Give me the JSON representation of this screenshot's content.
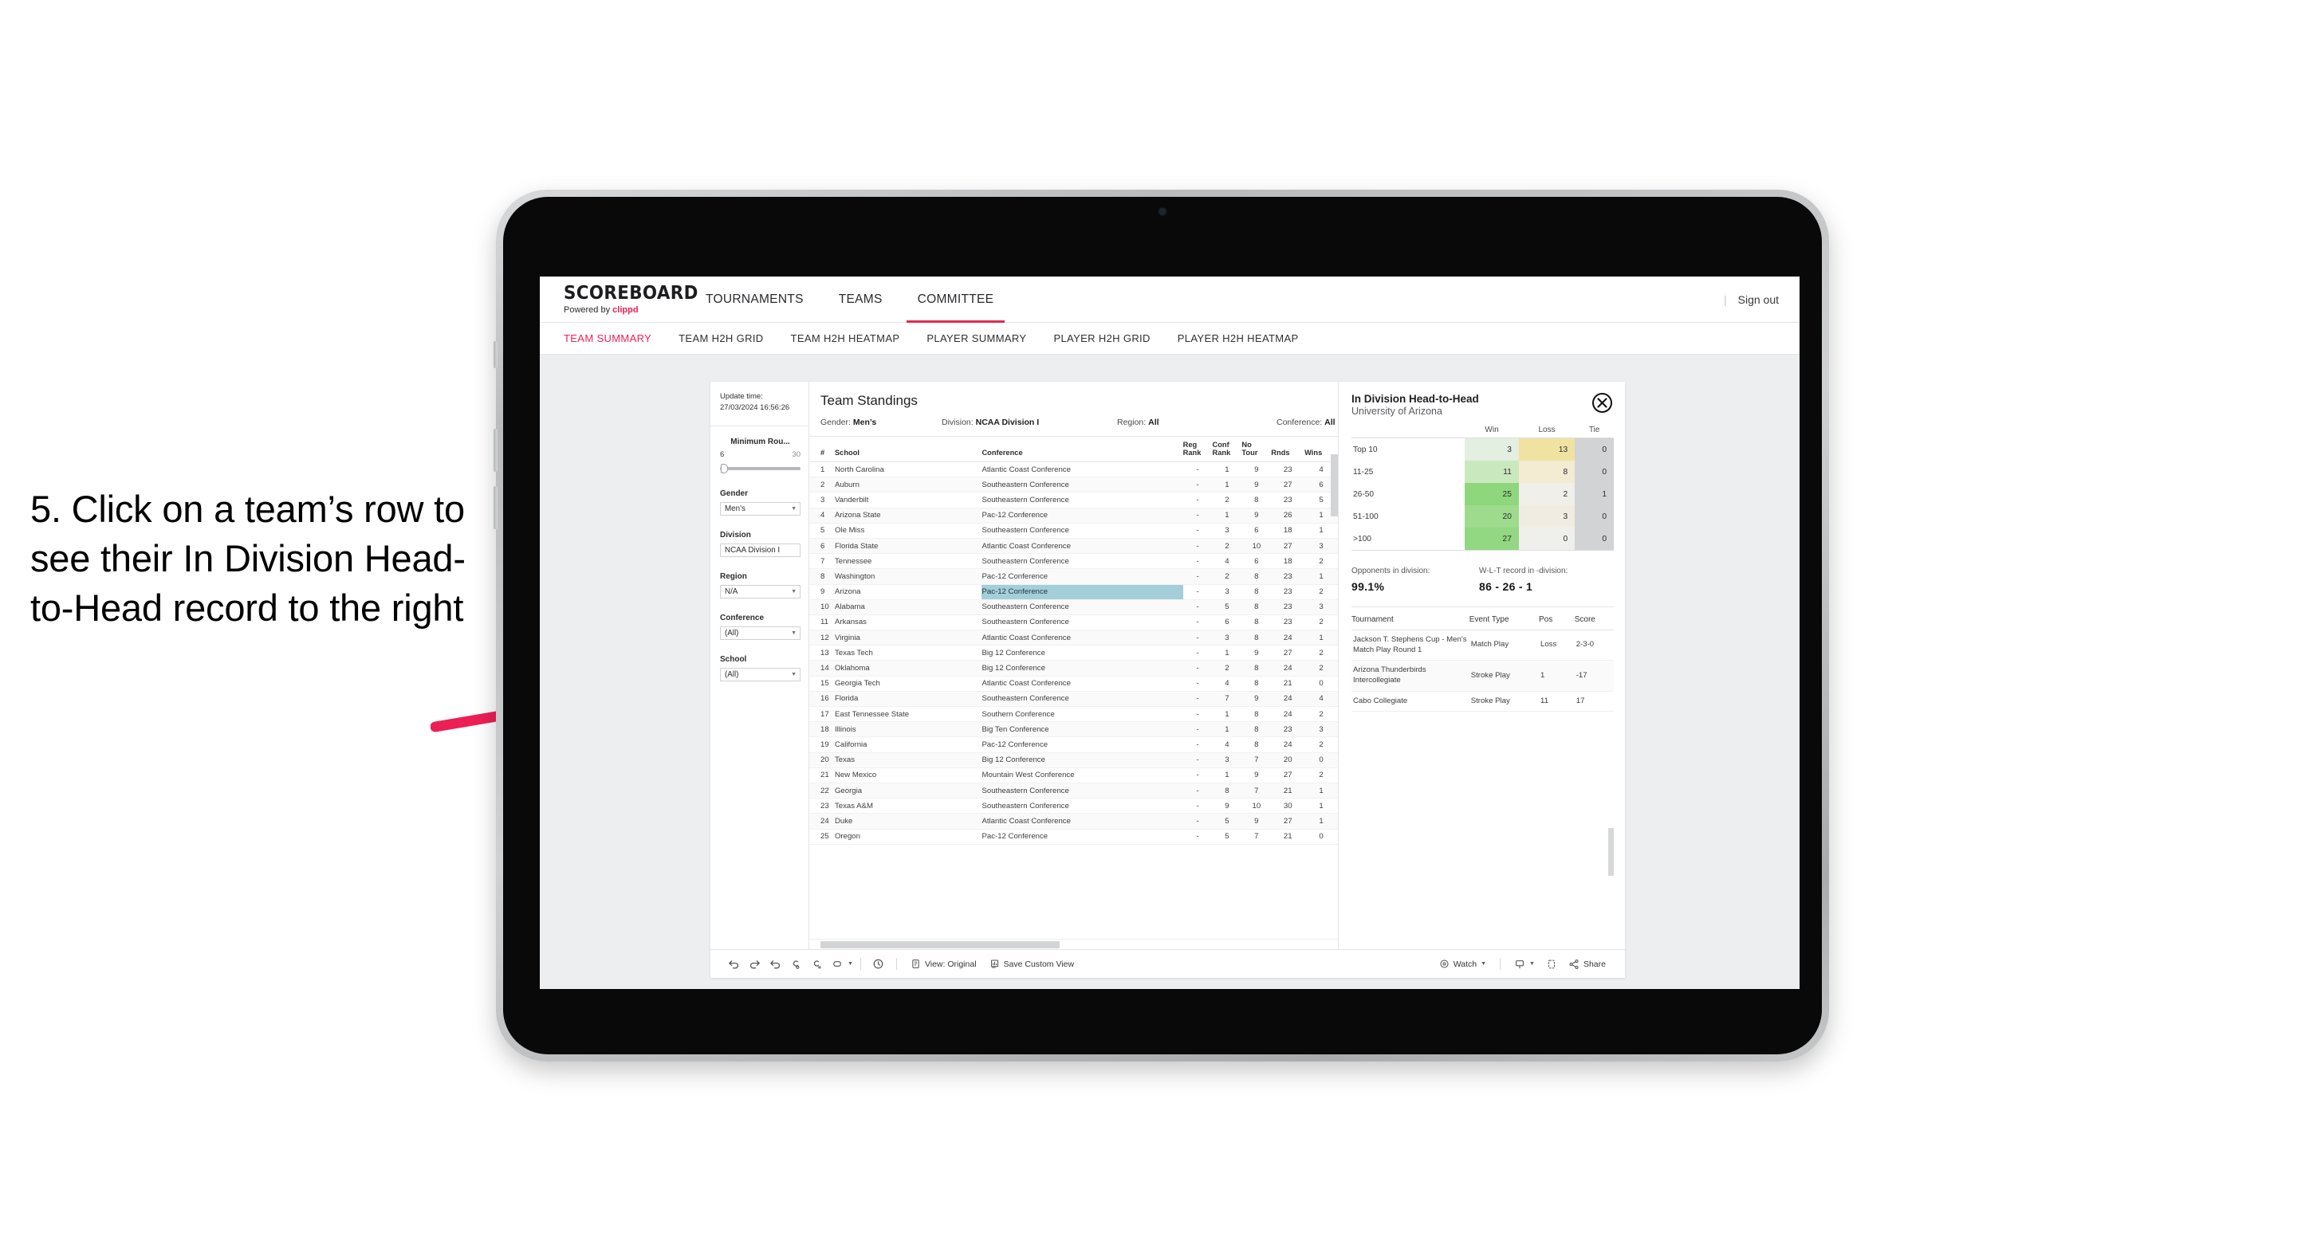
{
  "annotation": {
    "text": "5. Click on a team’s row to see their In Division Head-to-Head record to the right",
    "arrow_color": "#ec2055"
  },
  "app": {
    "logo": {
      "main": "SCOREBOARD",
      "powered_prefix": "Powered by ",
      "brand": "clippd"
    },
    "top_nav": [
      {
        "label": "TOURNAMENTS",
        "active": false
      },
      {
        "label": "TEAMS",
        "active": false
      },
      {
        "label": "COMMITTEE",
        "active": true
      }
    ],
    "sign_out": "Sign out",
    "divider": "|",
    "sub_nav": [
      {
        "label": "TEAM SUMMARY",
        "active": true
      },
      {
        "label": "TEAM H2H GRID",
        "active": false
      },
      {
        "label": "TEAM H2H HEATMAP",
        "active": false
      },
      {
        "label": "PLAYER SUMMARY",
        "active": false
      },
      {
        "label": "PLAYER H2H GRID",
        "active": false
      },
      {
        "label": "PLAYER H2H HEATMAP",
        "active": false
      }
    ]
  },
  "filters": {
    "update_time_label": "Update time:",
    "update_time_value": "27/03/2024 16:56:26",
    "min_rounds": {
      "label": "Minimum Rou...",
      "min": "6",
      "max": "30"
    },
    "gender": {
      "label": "Gender",
      "value": "Men’s"
    },
    "division": {
      "label": "Division",
      "value": "NCAA Division I"
    },
    "region": {
      "label": "Region",
      "value": "N/A"
    },
    "conference": {
      "label": "Conference",
      "value": "(All)"
    },
    "school": {
      "label": "School",
      "value": "(All)"
    }
  },
  "standings": {
    "title": "Team Standings",
    "meta": {
      "gender_label": "Gender: ",
      "gender_value": "Men’s",
      "division_label": "Division: ",
      "division_value": "NCAA Division I",
      "region_label": "Region: ",
      "region_value": "All",
      "conference_label": "Conference: ",
      "conference_value": "All"
    },
    "columns": [
      "#",
      "School",
      "Conference",
      "Reg Rank",
      "Conf Rank",
      "No Tour",
      "Rnds",
      "Wins"
    ],
    "columns_split": [
      {
        "l1": "#",
        "l2": ""
      },
      {
        "l1": "School",
        "l2": ""
      },
      {
        "l1": "Conference",
        "l2": ""
      },
      {
        "l1": "Reg",
        "l2": "Rank"
      },
      {
        "l1": "Conf",
        "l2": "Rank"
      },
      {
        "l1": "No",
        "l2": "Tour"
      },
      {
        "l1": "",
        "l2": "Rnds"
      },
      {
        "l1": "",
        "l2": "Wins"
      }
    ],
    "highlight_rank": 9,
    "rows": [
      {
        "rank": "1",
        "school": "North Carolina",
        "conference": "Atlantic Coast Conference",
        "reg_rank": "-",
        "conf_rank": "1",
        "no_tour": "9",
        "rnds": "23",
        "wins": "4"
      },
      {
        "rank": "2",
        "school": "Auburn",
        "conference": "Southeastern Conference",
        "reg_rank": "-",
        "conf_rank": "1",
        "no_tour": "9",
        "rnds": "27",
        "wins": "6"
      },
      {
        "rank": "3",
        "school": "Vanderbilt",
        "conference": "Southeastern Conference",
        "reg_rank": "-",
        "conf_rank": "2",
        "no_tour": "8",
        "rnds": "23",
        "wins": "5"
      },
      {
        "rank": "4",
        "school": "Arizona State",
        "conference": "Pac-12 Conference",
        "reg_rank": "-",
        "conf_rank": "1",
        "no_tour": "9",
        "rnds": "26",
        "wins": "1"
      },
      {
        "rank": "5",
        "school": "Ole Miss",
        "conference": "Southeastern Conference",
        "reg_rank": "-",
        "conf_rank": "3",
        "no_tour": "6",
        "rnds": "18",
        "wins": "1"
      },
      {
        "rank": "6",
        "school": "Florida State",
        "conference": "Atlantic Coast Conference",
        "reg_rank": "-",
        "conf_rank": "2",
        "no_tour": "10",
        "rnds": "27",
        "wins": "3"
      },
      {
        "rank": "7",
        "school": "Tennessee",
        "conference": "Southeastern Conference",
        "reg_rank": "-",
        "conf_rank": "4",
        "no_tour": "6",
        "rnds": "18",
        "wins": "2"
      },
      {
        "rank": "8",
        "school": "Washington",
        "conference": "Pac-12 Conference",
        "reg_rank": "-",
        "conf_rank": "2",
        "no_tour": "8",
        "rnds": "23",
        "wins": "1"
      },
      {
        "rank": "9",
        "school": "Arizona",
        "conference": "Pac-12 Conference",
        "reg_rank": "-",
        "conf_rank": "3",
        "no_tour": "8",
        "rnds": "23",
        "wins": "2"
      },
      {
        "rank": "10",
        "school": "Alabama",
        "conference": "Southeastern Conference",
        "reg_rank": "-",
        "conf_rank": "5",
        "no_tour": "8",
        "rnds": "23",
        "wins": "3"
      },
      {
        "rank": "11",
        "school": "Arkansas",
        "conference": "Southeastern Conference",
        "reg_rank": "-",
        "conf_rank": "6",
        "no_tour": "8",
        "rnds": "23",
        "wins": "2"
      },
      {
        "rank": "12",
        "school": "Virginia",
        "conference": "Atlantic Coast Conference",
        "reg_rank": "-",
        "conf_rank": "3",
        "no_tour": "8",
        "rnds": "24",
        "wins": "1"
      },
      {
        "rank": "13",
        "school": "Texas Tech",
        "conference": "Big 12 Conference",
        "reg_rank": "-",
        "conf_rank": "1",
        "no_tour": "9",
        "rnds": "27",
        "wins": "2"
      },
      {
        "rank": "14",
        "school": "Oklahoma",
        "conference": "Big 12 Conference",
        "reg_rank": "-",
        "conf_rank": "2",
        "no_tour": "8",
        "rnds": "24",
        "wins": "2"
      },
      {
        "rank": "15",
        "school": "Georgia Tech",
        "conference": "Atlantic Coast Conference",
        "reg_rank": "-",
        "conf_rank": "4",
        "no_tour": "8",
        "rnds": "21",
        "wins": "0"
      },
      {
        "rank": "16",
        "school": "Florida",
        "conference": "Southeastern Conference",
        "reg_rank": "-",
        "conf_rank": "7",
        "no_tour": "9",
        "rnds": "24",
        "wins": "4"
      },
      {
        "rank": "17",
        "school": "East Tennessee State",
        "conference": "Southern Conference",
        "reg_rank": "-",
        "conf_rank": "1",
        "no_tour": "8",
        "rnds": "24",
        "wins": "2"
      },
      {
        "rank": "18",
        "school": "Illinois",
        "conference": "Big Ten Conference",
        "reg_rank": "-",
        "conf_rank": "1",
        "no_tour": "8",
        "rnds": "23",
        "wins": "3"
      },
      {
        "rank": "19",
        "school": "California",
        "conference": "Pac-12 Conference",
        "reg_rank": "-",
        "conf_rank": "4",
        "no_tour": "8",
        "rnds": "24",
        "wins": "2"
      },
      {
        "rank": "20",
        "school": "Texas",
        "conference": "Big 12 Conference",
        "reg_rank": "-",
        "conf_rank": "3",
        "no_tour": "7",
        "rnds": "20",
        "wins": "0"
      },
      {
        "rank": "21",
        "school": "New Mexico",
        "conference": "Mountain West Conference",
        "reg_rank": "-",
        "conf_rank": "1",
        "no_tour": "9",
        "rnds": "27",
        "wins": "2"
      },
      {
        "rank": "22",
        "school": "Georgia",
        "conference": "Southeastern Conference",
        "reg_rank": "-",
        "conf_rank": "8",
        "no_tour": "7",
        "rnds": "21",
        "wins": "1"
      },
      {
        "rank": "23",
        "school": "Texas A&M",
        "conference": "Southeastern Conference",
        "reg_rank": "-",
        "conf_rank": "9",
        "no_tour": "10",
        "rnds": "30",
        "wins": "1"
      },
      {
        "rank": "24",
        "school": "Duke",
        "conference": "Atlantic Coast Conference",
        "reg_rank": "-",
        "conf_rank": "5",
        "no_tour": "9",
        "rnds": "27",
        "wins": "1"
      },
      {
        "rank": "25",
        "school": "Oregon",
        "conference": "Pac-12 Conference",
        "reg_rank": "-",
        "conf_rank": "5",
        "no_tour": "7",
        "rnds": "21",
        "wins": "0"
      }
    ]
  },
  "h2h": {
    "title": "In Division Head-to-Head",
    "subtitle": "University of Arizona",
    "close_icon": "close-circle-icon",
    "columns": [
      "",
      "Win",
      "Loss",
      "Tie"
    ],
    "rows": [
      {
        "band": "Top 10",
        "win": "3",
        "loss": "13",
        "tie": "0",
        "win_color": "#e2efe0",
        "loss_color": "#f0e2a0",
        "tie_color": "#d2d3d4"
      },
      {
        "band": "11-25",
        "win": "11",
        "loss": "8",
        "tie": "0",
        "win_color": "#c9e7bd",
        "loss_color": "#f3ead0",
        "tie_color": "#d2d3d4"
      },
      {
        "band": "26-50",
        "win": "25",
        "loss": "2",
        "tie": "1",
        "win_color": "#8ed униform",
        "loss_color": "#f0efe8",
        "tie_color": "#d2d3d4"
      },
      {
        "band": "51-100",
        "win": "20",
        "loss": "3",
        "tie": "0",
        "win_color": "#9edb8d",
        "loss_color": "#f1ece0",
        "tie_color": "#d2d3d4"
      },
      {
        "band": ">100",
        "win": "27",
        "loss": "0",
        "tie": "0",
        "win_color": "#92d782",
        "loss_color": "#eff0ec",
        "tie_color": "#d2d3d4"
      }
    ],
    "stats": {
      "opponents_label": "Opponents in division:",
      "opponents_value": "99.1%",
      "record_label": "W-L-T record in -division:",
      "record_value": "86 - 26 - 1"
    },
    "tournaments": {
      "columns": [
        "Tournament",
        "Event Type",
        "Pos",
        "Score"
      ],
      "rows": [
        {
          "name": "Jackson T. Stephens Cup - Men’s Match Play Round 1",
          "type": "Match Play",
          "pos": "Loss",
          "score": "2-3-0"
        },
        {
          "name": "Arizona Thunderbirds Intercollegiate",
          "type": "Stroke Play",
          "pos": "1",
          "score": "-17"
        },
        {
          "name": "Cabo Collegiate",
          "type": "Stroke Play",
          "pos": "11",
          "score": "17"
        }
      ]
    }
  },
  "toolbar": {
    "icons": [
      "undo-icon",
      "redo-icon",
      "revert-icon",
      "refresh-icon",
      "pause-icon",
      "device-layout-icon"
    ],
    "view_label": "View: Original",
    "save_view_label": "Save Custom View",
    "watch_label": "Watch",
    "share_label": "Share",
    "view_icon": "view-original-icon",
    "save_icon": "save-view-icon",
    "watch_icon": "watch-icon",
    "comment_icon": "comment-icon",
    "device-icon": "device-preview-icon",
    "share_icon": "share-icon"
  }
}
